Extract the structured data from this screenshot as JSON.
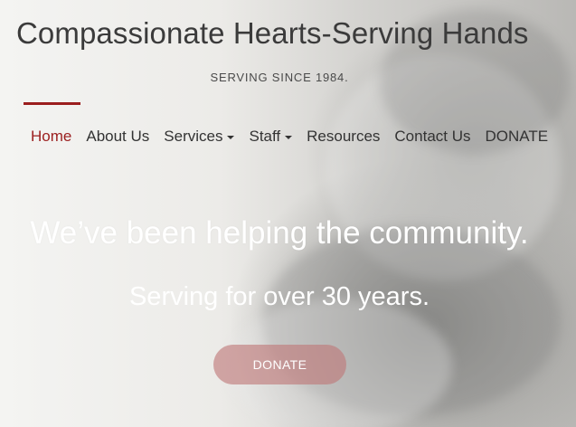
{
  "site": {
    "title": "Compassionate Hearts-Serving Hands",
    "tagline": "SERVING SINCE 1984."
  },
  "nav": {
    "items": [
      {
        "label": "Home",
        "active": true,
        "dropdown": false
      },
      {
        "label": "About Us",
        "active": false,
        "dropdown": false
      },
      {
        "label": "Services",
        "active": false,
        "dropdown": true
      },
      {
        "label": "Staff",
        "active": false,
        "dropdown": true
      },
      {
        "label": "Resources",
        "active": false,
        "dropdown": false
      },
      {
        "label": "Contact Us",
        "active": false,
        "dropdown": false
      },
      {
        "label": "DONATE",
        "active": false,
        "dropdown": false
      }
    ]
  },
  "hero": {
    "headline": "We’ve been helping the community.",
    "subheadline": "Serving for over 30 years.",
    "button_label": "DONATE"
  },
  "colors": {
    "accent": "#9b1e1e",
    "button": "#be7878",
    "text": "#333333"
  }
}
